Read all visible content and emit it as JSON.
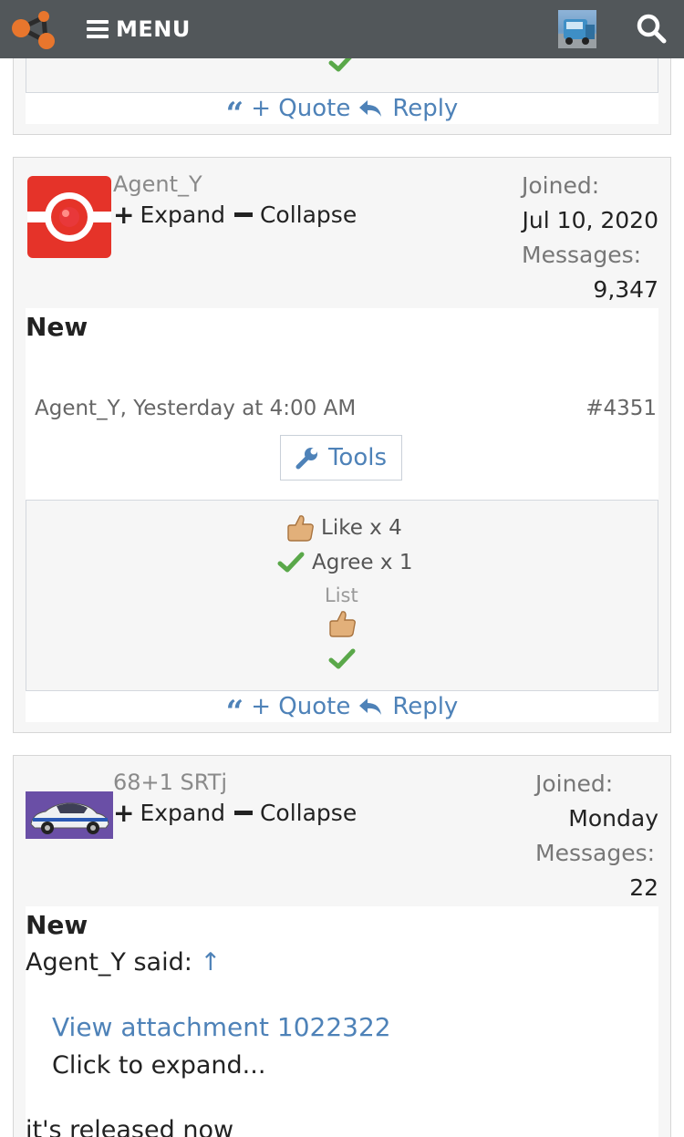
{
  "nav": {
    "menu_label": "MENU",
    "logo_icon": "network-logo-icon",
    "search_icon": "search-icon"
  },
  "actions": {
    "quote_label": "+ Quote",
    "reply_label": "Reply"
  },
  "post1": {
    "username": "Agent_Y",
    "expand_label": "Expand",
    "collapse_label": "Collapse",
    "joined_label": "Joined:",
    "joined_value": "Jul 10, 2020",
    "messages_label": "Messages:",
    "messages_value": "9,347",
    "new_label": "New",
    "meta": "Agent_Y, Yesterday at 4:00 AM",
    "post_number": "#4351",
    "tools_label": "Tools",
    "reactions": [
      {
        "label": "Like x 4",
        "icon": "thumbs-up-icon"
      },
      {
        "label": "Agree x 1",
        "icon": "checkmark-icon"
      }
    ],
    "list_label": "List"
  },
  "post2": {
    "username": "68+1 SRTj",
    "expand_label": "Expand",
    "collapse_label": "Collapse",
    "joined_label": "Joined:",
    "joined_value": "Monday",
    "messages_label": "Messages:",
    "messages_value": "22",
    "new_label": "New",
    "quote_author": "Agent_Y said:",
    "quote_arrow": "↑",
    "attachment_link": "View attachment 1022322",
    "click_expand": "Click to expand...",
    "body_text": "it's released now"
  },
  "colors": {
    "nav_bg": "#52575a",
    "link": "#4e82b8",
    "accent_orange": "#e8762d"
  }
}
